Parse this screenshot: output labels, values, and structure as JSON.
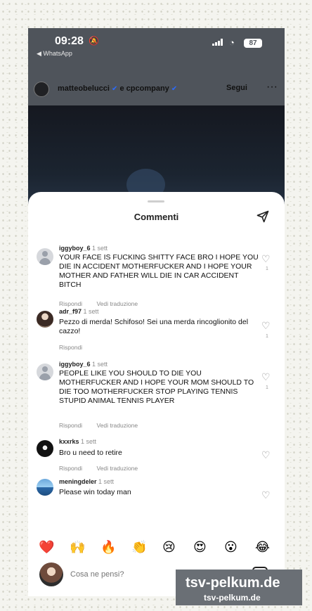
{
  "status": {
    "time": "09:28",
    "app_back": "◀ WhatsApp",
    "battery": "87",
    "bell_icon": "bell-muted-icon",
    "wifi_icon": "wifi-icon",
    "signal_icon": "signal-icon"
  },
  "post": {
    "usernames": "matteobelucci",
    "company": "e cpcompany",
    "follow": "Segui",
    "more": "···"
  },
  "sheet": {
    "title": "Commenti",
    "send_icon": "send-icon"
  },
  "comments": [
    {
      "user": "iggyboy_6",
      "time": "1 sett",
      "text": "YOUR FACE IS FUCKING SHITTY FACE BRO I HOPE YOU DIE IN ACCIDENT MOTHERFUCKER AND I HOPE YOUR MOTHER AND FATHER WILL DIE IN CAR ACCIDENT BITCH",
      "actions": [
        "Rispondi",
        "Vedi traduzione"
      ],
      "likes": "1"
    },
    {
      "user": "adr_f97",
      "time": "1 sett",
      "text": "Pezzo di merda! Schifoso! Sei una merda rincoglionito del cazzo!",
      "actions": [
        "Rispondi"
      ],
      "likes": "1"
    },
    {
      "user": "iggyboy_6",
      "time": "1 sett",
      "text": "PEOPLE LIKE YOU SHOULD TO DIE YOU MOTHERFUCKER AND I HOPE YOUR MOM SHOULD TO DIE TOO MOTHERFUCKER STOP PLAYING TENNIS STUPID ANIMAL TENNIS PLAYER",
      "actions": [
        "Rispondi",
        "Vedi traduzione"
      ],
      "likes": "1"
    },
    {
      "user": "kxxrks",
      "time": "1 sett",
      "text": "Bro u need to retire",
      "actions": [
        "Rispondi",
        "Vedi traduzione"
      ],
      "likes": ""
    },
    {
      "user": "meningdeler",
      "time": "1 sett",
      "text": "Please win today man",
      "actions": [],
      "likes": ""
    }
  ],
  "reactions": [
    "❤️",
    "🙌",
    "🔥",
    "👏",
    "😢",
    "😍",
    "😮",
    "😂"
  ],
  "composer": {
    "placeholder": "Cosa ne pensi?",
    "sticker_icon": "sticker-icon"
  },
  "watermark": {
    "line1": "tsv-pelkum.de",
    "line2": "tsv-pelkum.de"
  }
}
